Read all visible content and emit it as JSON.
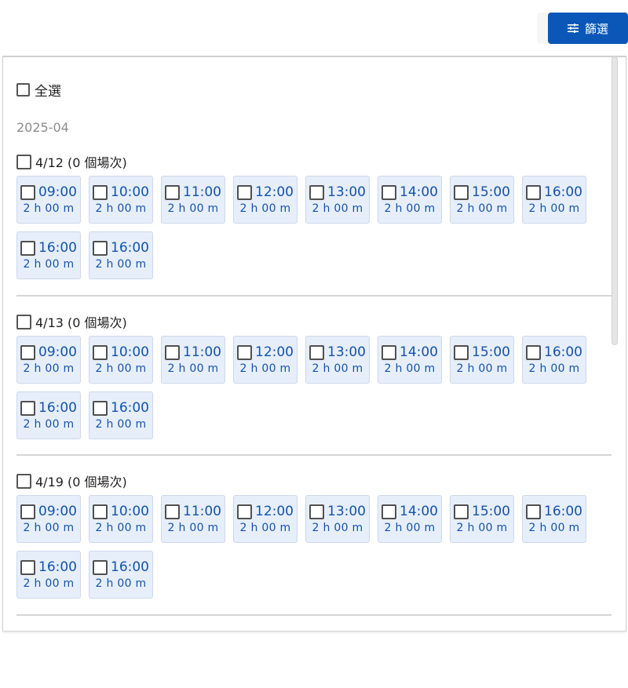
{
  "toolbar": {
    "filter_label": "篩選",
    "filter_icon": "tune-icon",
    "accent": "#0b57b8"
  },
  "select_all": {
    "label": "全選"
  },
  "month": "2025-04",
  "days": [
    {
      "label": "4/12 (0 個場次)",
      "slots": [
        {
          "time": "09:00",
          "duration": "2 h 00 m"
        },
        {
          "time": "10:00",
          "duration": "2 h 00 m"
        },
        {
          "time": "11:00",
          "duration": "2 h 00 m"
        },
        {
          "time": "12:00",
          "duration": "2 h 00 m"
        },
        {
          "time": "13:00",
          "duration": "2 h 00 m"
        },
        {
          "time": "14:00",
          "duration": "2 h 00 m"
        },
        {
          "time": "15:00",
          "duration": "2 h 00 m"
        },
        {
          "time": "16:00",
          "duration": "2 h 00 m"
        },
        {
          "time": "16:00",
          "duration": "2 h 00 m"
        },
        {
          "time": "16:00",
          "duration": "2 h 00 m"
        }
      ]
    },
    {
      "label": "4/13 (0 個場次)",
      "slots": [
        {
          "time": "09:00",
          "duration": "2 h 00 m"
        },
        {
          "time": "10:00",
          "duration": "2 h 00 m"
        },
        {
          "time": "11:00",
          "duration": "2 h 00 m"
        },
        {
          "time": "12:00",
          "duration": "2 h 00 m"
        },
        {
          "time": "13:00",
          "duration": "2 h 00 m"
        },
        {
          "time": "14:00",
          "duration": "2 h 00 m"
        },
        {
          "time": "15:00",
          "duration": "2 h 00 m"
        },
        {
          "time": "16:00",
          "duration": "2 h 00 m"
        },
        {
          "time": "16:00",
          "duration": "2 h 00 m"
        },
        {
          "time": "16:00",
          "duration": "2 h 00 m"
        }
      ]
    },
    {
      "label": "4/19 (0 個場次)",
      "slots": [
        {
          "time": "09:00",
          "duration": "2 h 00 m"
        },
        {
          "time": "10:00",
          "duration": "2 h 00 m"
        },
        {
          "time": "11:00",
          "duration": "2 h 00 m"
        },
        {
          "time": "12:00",
          "duration": "2 h 00 m"
        },
        {
          "time": "13:00",
          "duration": "2 h 00 m"
        },
        {
          "time": "14:00",
          "duration": "2 h 00 m"
        },
        {
          "time": "15:00",
          "duration": "2 h 00 m"
        },
        {
          "time": "16:00",
          "duration": "2 h 00 m"
        },
        {
          "time": "16:00",
          "duration": "2 h 00 m"
        },
        {
          "time": "16:00",
          "duration": "2 h 00 m"
        }
      ]
    }
  ]
}
